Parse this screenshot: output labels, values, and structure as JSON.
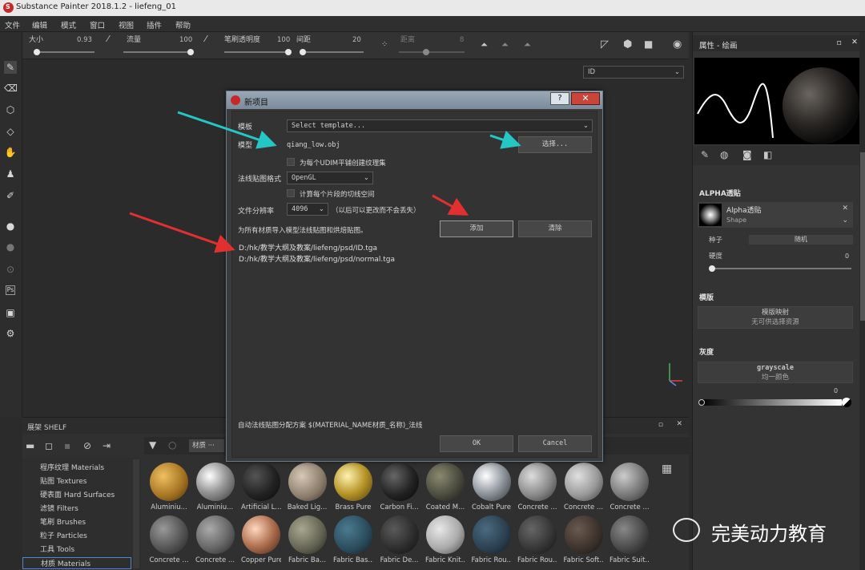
{
  "app": {
    "title": "Substance Painter 2018.1.2 - liefeng_01"
  },
  "menu": [
    "文件",
    "编辑",
    "模式",
    "窗口",
    "视图",
    "插件",
    "帮助"
  ],
  "toolbar": {
    "size_label": "大小",
    "size_value": "0.93",
    "flow_label": "流量",
    "flow_value": "100",
    "stroke_opacity_label": "笔刷透明度",
    "stroke_opacity_value": "100",
    "spacing_label": "间距",
    "spacing_value": "20",
    "distance_label": "距离",
    "distance_value": "8"
  },
  "viewport": {
    "channel_select": "ID"
  },
  "dialog": {
    "title": "新项目",
    "help": "?",
    "template_label": "模板",
    "template_value": "Select template...",
    "mesh_label": "模型",
    "mesh_value": "qiang_low.obj",
    "select_button": "选择...",
    "udim_checkbox": "为每个UDIM平铺创建纹理集",
    "normal_format_label": "法线贴图格式",
    "normal_format_value": "OpenGL",
    "tangent_checkbox": "计算每个片段的切线空间",
    "resolution_label": "文件分辨率",
    "resolution_value": "4096",
    "resolution_note": "（以后可以更改而不会丢失）",
    "import_label": "为所有材质导入模型法线贴图和烘焙贴图。",
    "add_button": "添加",
    "clear_button": "清除",
    "files": [
      "D:/hk/教学大纲及教案/liefeng/psd/ID.tga",
      "D:/hk/教学大纲及教案/liefeng/psd/normal.tga"
    ],
    "auto_assign": "自动法线贴图分配方案 $(MATERIAL_NAME材质_名称)_法线",
    "ok_button": "OK",
    "cancel_button": "Cancel"
  },
  "right_panel": {
    "header": "属性 - 绘画",
    "alpha_title": "ALPHA透贴",
    "alpha_name": "Alpha透贴",
    "alpha_sub": "Shape",
    "seed_label": "种子",
    "seed_value": "随机",
    "hardness_label": "硬度",
    "hardness_value": "0",
    "stencil_title": "模版",
    "stencil_btn_line1": "模版映射",
    "stencil_btn_line2": "无可供选择资源",
    "gray_title": "灰度",
    "gray_btn_line1": "grayscale",
    "gray_btn_line2": "均一颜色",
    "gray_value": "0"
  },
  "shelf": {
    "title": "展架 SHELF",
    "filter_tag": "材质 ···",
    "categories": [
      "程序纹理 Materials",
      "贴图 Textures",
      "硬表面 Hard Surfaces",
      "滤镜 Filters",
      "笔刷 Brushes",
      "粒子 Particles",
      "工具 Tools",
      "材质 Materials"
    ],
    "materials_row1": [
      "Aluminiu...",
      "Aluminiu...",
      "Artificial L...",
      "Baked Lig...",
      "Brass Pure",
      "Carbon Fi...",
      "Coated M...",
      "Cobalt Pure",
      "Concrete ...",
      "Concrete ...",
      "Concrete ..."
    ],
    "materials_row2": [
      "Concrete ...",
      "Concrete ...",
      "Copper Pure",
      "Fabric Ba...",
      "Fabric Bas...",
      "Fabric De...",
      "Fabric Knit...",
      "Fabric Rou...",
      "Fabric Rou...",
      "Fabric Soft...",
      "Fabric Suit..."
    ]
  },
  "watermark": "完美动力教育",
  "colors": {
    "arrow_cyan": "#25c6c6",
    "arrow_red": "#e03030",
    "dialog_title": "#8a9aa8"
  }
}
